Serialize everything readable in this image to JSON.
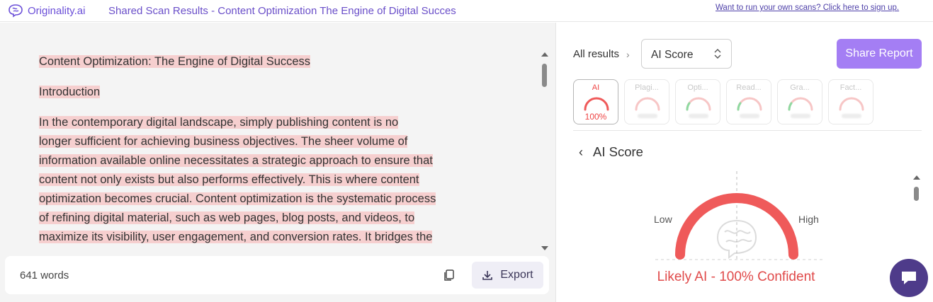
{
  "header": {
    "brand": "Originality.ai",
    "title": "Shared Scan Results - Content Optimization The Engine of Digital Succes",
    "signup": "Want to run your own scans? Click here to sign up."
  },
  "document": {
    "heading": "Content Optimization: The Engine of Digital Success",
    "intro": "Introduction",
    "lines": [
      "In the contemporary digital landscape, simply publishing content is no",
      "longer sufficient for achieving business objectives. The sheer volume of",
      "information available online necessitates a strategic approach to ensure that",
      "content not only exists but also performs effectively. This is where content",
      "optimization becomes crucial. Content optimization is the systematic process",
      "of refining digital material, such as web pages, blog posts, and videos, to",
      "maximize its visibility, user engagement, and conversion rates. It bridges the"
    ]
  },
  "footer": {
    "words": "641 words",
    "export": "Export"
  },
  "panel": {
    "crumb": "All results",
    "select_value": "AI Score",
    "share": "Share Report",
    "tiles": [
      {
        "name": "AI",
        "value": "100%",
        "active": true
      },
      {
        "name": "Plagi...",
        "active": false
      },
      {
        "name": "Opti...",
        "active": false
      },
      {
        "name": "Read...",
        "active": false
      },
      {
        "name": "Gra...",
        "active": false
      },
      {
        "name": "Fact...",
        "active": false
      }
    ],
    "section_title": "AI Score",
    "gauge": {
      "low": "Low",
      "high": "High",
      "score_fraction": 1.0
    },
    "verdict": "Likely AI - 100% Confident"
  },
  "colors": {
    "brand": "#6b4fd8",
    "accent": "#a47ef4",
    "highlight": "#f6cfcf",
    "ai_red": "#ef5a5a",
    "chat": "#4e3b8a"
  },
  "icons": [
    "brain-logo-icon",
    "copy-icon",
    "download-icon",
    "chevron-right-icon",
    "select-arrows-icon",
    "back-chevron-icon",
    "chat-icon"
  ]
}
